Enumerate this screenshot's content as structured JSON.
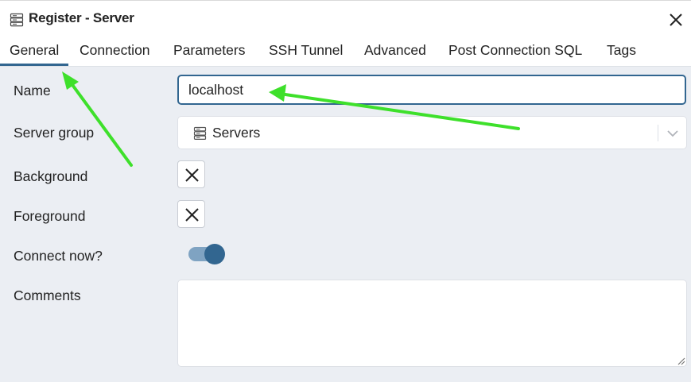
{
  "window": {
    "title": "Register - Server",
    "title_icon": "server-icon",
    "close_icon": "close-icon"
  },
  "tabs": [
    {
      "label": "General",
      "active": true
    },
    {
      "label": "Connection",
      "active": false
    },
    {
      "label": "Parameters",
      "active": false
    },
    {
      "label": "SSH Tunnel",
      "active": false
    },
    {
      "label": "Advanced",
      "active": false
    },
    {
      "label": "Post Connection SQL",
      "active": false
    },
    {
      "label": "Tags",
      "active": false
    }
  ],
  "form": {
    "name": {
      "label": "Name",
      "value": "localhost"
    },
    "server_group": {
      "label": "Server group",
      "value": "Servers",
      "icon": "server-group-icon",
      "dropdown_icon": "chevron-down-icon"
    },
    "background": {
      "label": "Background",
      "icon": "no-color-x-icon"
    },
    "foreground": {
      "label": "Foreground",
      "icon": "no-color-x-icon"
    },
    "connect_now": {
      "label": "Connect now?",
      "checked": true
    },
    "comments": {
      "label": "Comments",
      "value": ""
    }
  },
  "colors": {
    "accent": "#326690",
    "toggle_track": "#7fa3c2",
    "panel_bg": "#ebeef3",
    "annotation_arrow": "#3ee02b"
  },
  "annotations": {
    "arrow_icon": "green-arrow-annotation"
  }
}
